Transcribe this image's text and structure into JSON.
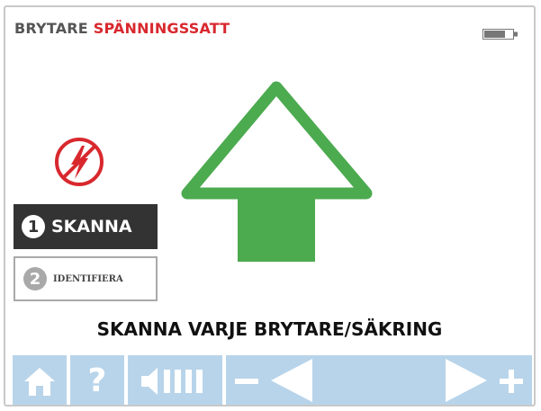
{
  "header": {
    "label": "BRYTARE",
    "status": "SPÄNNINGSSATT"
  },
  "icons": {
    "battery": "battery-icon",
    "hazard": "voltage-hazard-icon",
    "arrow": "up-arrow-icon",
    "home": "home-icon",
    "help": "help-icon",
    "volume": "volume-icon",
    "minus": "minus-icon",
    "left": "left-arrow-icon",
    "right": "right-arrow-icon",
    "plus": "plus-icon"
  },
  "steps": [
    {
      "number": "1",
      "label": "SKANNA",
      "active": true
    },
    {
      "number": "2",
      "label": "IDENTIFIERA",
      "active": false
    }
  ],
  "instruction": "SKANNA VARJE BRYTARE/SÄKRING",
  "toolbar": {
    "help_glyph": "?"
  },
  "colors": {
    "accent_red": "#d8282e",
    "arrow_green": "#4caa4f",
    "toolbar_blue": "#b8d4ea",
    "toolbar_icon": "#ffffff",
    "active_step": "#333333"
  }
}
